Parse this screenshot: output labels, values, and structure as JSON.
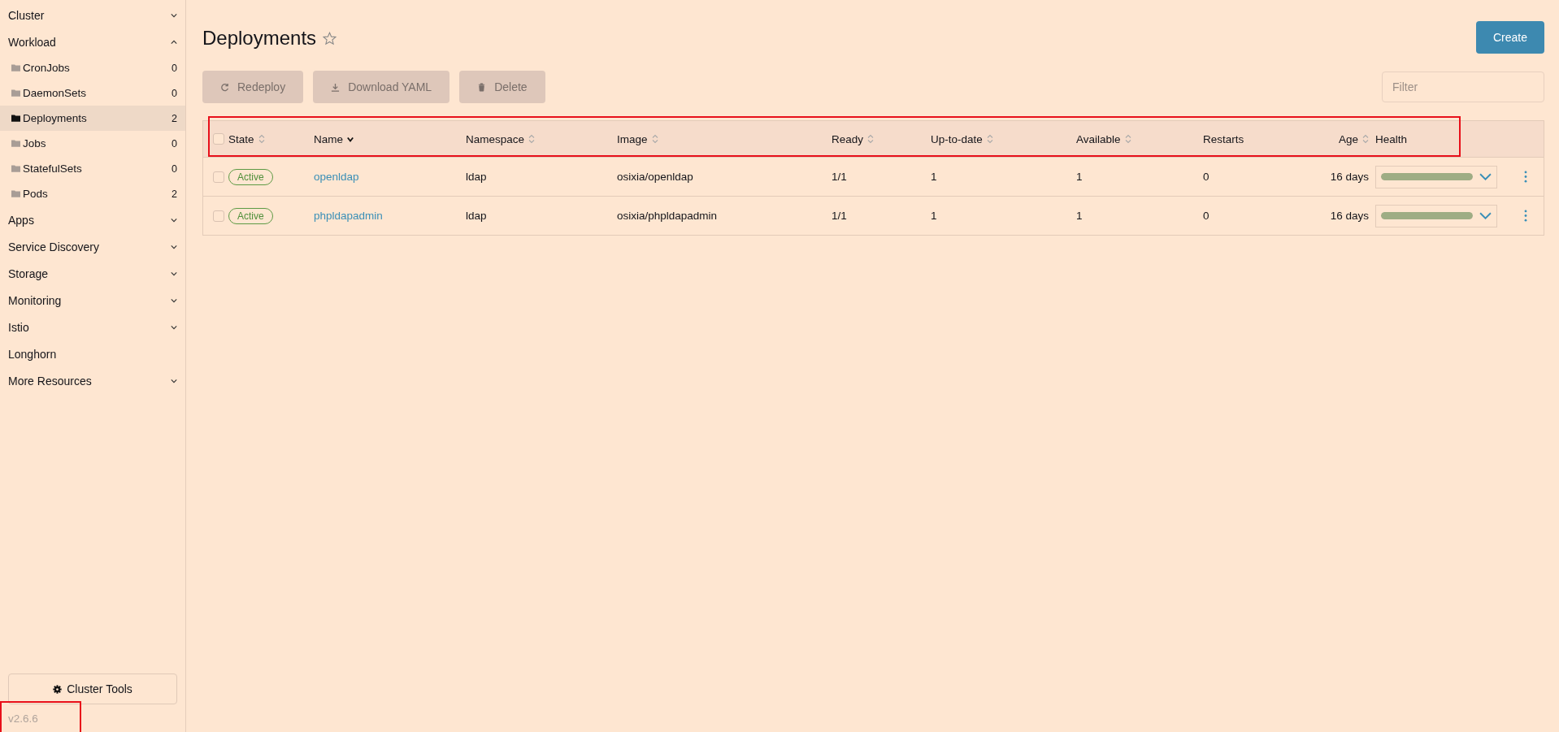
{
  "sidebar": {
    "items": [
      {
        "label": "Cluster",
        "kind": "group",
        "expanded": false
      },
      {
        "label": "Workload",
        "kind": "group",
        "expanded": true,
        "children": [
          {
            "label": "CronJobs",
            "count": "0",
            "selected": false
          },
          {
            "label": "DaemonSets",
            "count": "0",
            "selected": false
          },
          {
            "label": "Deployments",
            "count": "2",
            "selected": true
          },
          {
            "label": "Jobs",
            "count": "0",
            "selected": false
          },
          {
            "label": "StatefulSets",
            "count": "0",
            "selected": false
          },
          {
            "label": "Pods",
            "count": "2",
            "selected": false
          }
        ]
      },
      {
        "label": "Apps",
        "kind": "group",
        "expanded": false
      },
      {
        "label": "Service Discovery",
        "kind": "group",
        "expanded": false
      },
      {
        "label": "Storage",
        "kind": "group",
        "expanded": false
      },
      {
        "label": "Monitoring",
        "kind": "group",
        "expanded": false
      },
      {
        "label": "Istio",
        "kind": "group",
        "expanded": false
      },
      {
        "label": "Longhorn",
        "kind": "link"
      },
      {
        "label": "More Resources",
        "kind": "group",
        "expanded": false
      }
    ],
    "tools_button": "Cluster Tools",
    "version": {
      "text": "v2.6.6",
      "highlighted": true
    }
  },
  "page": {
    "title": "Deployments",
    "favorited": false,
    "create_button": "Create",
    "actions": [
      {
        "label": "Redeploy",
        "disabled": true
      },
      {
        "label": "Download YAML",
        "disabled": true
      },
      {
        "label": "Delete",
        "disabled": true
      }
    ],
    "filter": {
      "placeholder": "Filter"
    }
  },
  "table": {
    "header_highlighted": true,
    "all_selected": false,
    "columns": [
      {
        "label": "State",
        "sortable": true,
        "sorted": false
      },
      {
        "label": "Name",
        "sortable": true,
        "sorted": true
      },
      {
        "label": "Namespace",
        "sortable": true,
        "sorted": false
      },
      {
        "label": "Image",
        "sortable": true,
        "sorted": false
      },
      {
        "label": "Ready",
        "sortable": true,
        "sorted": false
      },
      {
        "label": "Up-to-date",
        "sortable": true,
        "sorted": false
      },
      {
        "label": "Available",
        "sortable": true,
        "sorted": false
      },
      {
        "label": "Restarts",
        "sortable": false
      },
      {
        "label": "Age",
        "sortable": true,
        "sorted": false
      },
      {
        "label": "Health",
        "sortable": false
      }
    ],
    "rows": [
      {
        "selected": false,
        "state": "Active",
        "name": "openldap",
        "namespace": "ldap",
        "image": "osixia/openldap",
        "ready": "1/1",
        "up_to_date": "1",
        "available": "1",
        "restarts": "0",
        "age": "16 days",
        "level": 1
      },
      {
        "selected": false,
        "state": "Active",
        "name": "phpldapadmin",
        "namespace": "ldap",
        "image": "osixia/phpldapadmin",
        "ready": "1/1",
        "up_to_date": "1",
        "available": "1",
        "restarts": "0",
        "age": "16 days",
        "level": 1
      }
    ]
  }
}
